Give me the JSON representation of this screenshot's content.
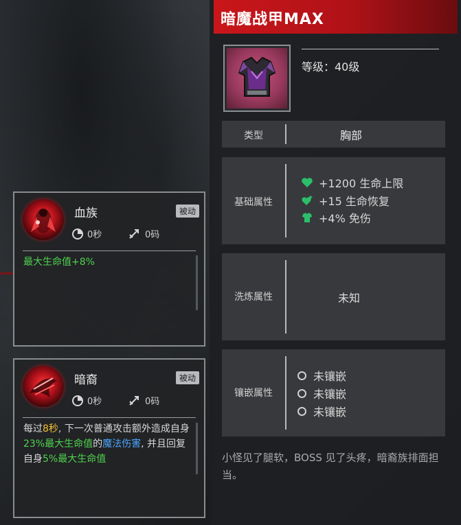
{
  "skills": [
    {
      "name": "血族",
      "badge": "被动",
      "cooldown": "0秒",
      "range": "0码",
      "description": [
        {
          "text": "最大生命值+8%",
          "color": "green"
        }
      ]
    },
    {
      "name": "暗裔",
      "badge": "被动",
      "cooldown": "0秒",
      "range": "0码",
      "description": [
        {
          "text": "每过",
          "color": "white"
        },
        {
          "text": "8秒",
          "color": "yellow"
        },
        {
          "text": ", 下一次普通攻击额外造成自身",
          "color": "white"
        },
        {
          "text": "23%最大生命值",
          "color": "green"
        },
        {
          "text": "的",
          "color": "white"
        },
        {
          "text": "魔法伤害",
          "color": "blue"
        },
        {
          "text": ", 并且回复自身",
          "color": "white"
        },
        {
          "text": "5%最大生命值",
          "color": "green"
        }
      ]
    }
  ],
  "item": {
    "title": "暗魔战甲MAX",
    "level": "等级：40级",
    "type_label": "类型",
    "type_value": "胸部",
    "base_label": "基础属性",
    "base_attrs": [
      {
        "text": "+1200 生命上限",
        "icon": "heart-icon"
      },
      {
        "text": "+15 生命恢复",
        "icon": "heart-plus-icon"
      },
      {
        "text": "+4% 免伤",
        "icon": "armor-icon"
      }
    ],
    "refine_label": "洗炼属性",
    "refine_value": "未知",
    "socket_label": "镶嵌属性",
    "sockets": [
      "未镶嵌",
      "未镶嵌",
      "未镶嵌"
    ],
    "flavor": "小怪见了腿软，BOSS 见了头疼，暗裔族排面担当。",
    "colors": {
      "header_red": "#c9161b",
      "attr_icon_green": "#2bbf6a"
    }
  }
}
